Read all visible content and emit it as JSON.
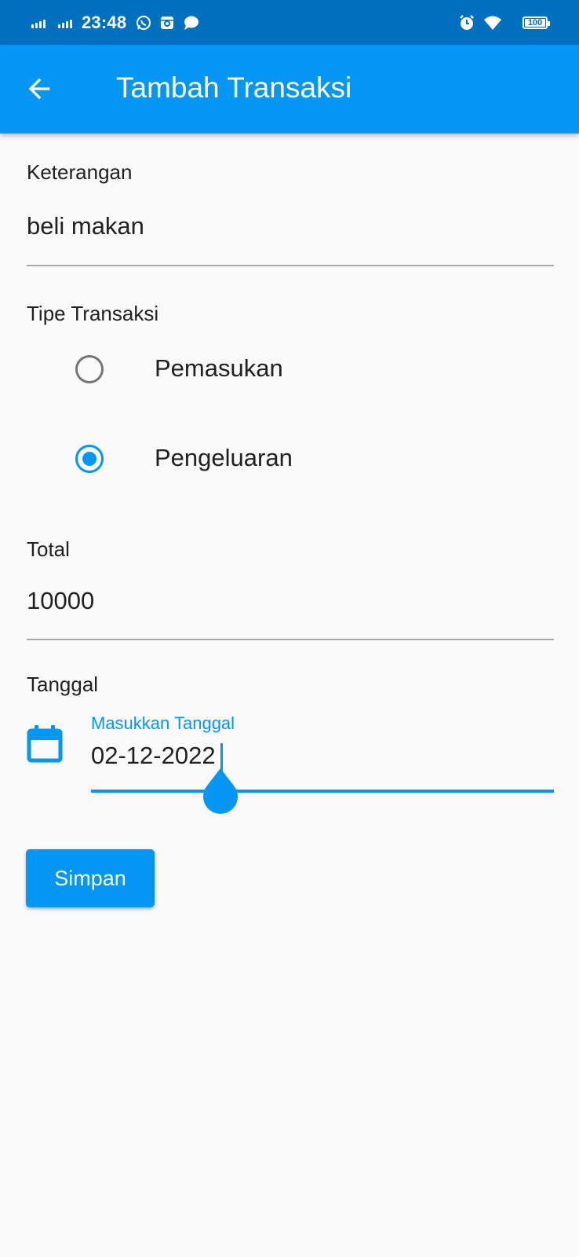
{
  "status_bar": {
    "time": "23:48",
    "battery": "100",
    "left_icons": [
      "signal-icon",
      "signal-icon",
      "whatsapp-icon",
      "instagram-icon",
      "message-icon"
    ],
    "right_icons": [
      "alarm-icon",
      "wifi-icon",
      "battery-icon"
    ]
  },
  "app_bar": {
    "title": "Tambah Transaksi",
    "back_icon": "arrow-left-icon",
    "color": "#0396f2"
  },
  "form": {
    "keterangan": {
      "label": "Keterangan",
      "value": "beli makan"
    },
    "tipe": {
      "label": "Tipe Transaksi",
      "options": [
        {
          "label": "Pemasukan",
          "selected": false
        },
        {
          "label": "Pengeluaran",
          "selected": true
        }
      ]
    },
    "total": {
      "label": "Total",
      "value": "10000"
    },
    "tanggal": {
      "label": "Tanggal",
      "input_label": "Masukkan Tanggal",
      "value": "02-12-2022",
      "icon": "calendar-icon"
    },
    "save_label": "Simpan"
  },
  "colors": {
    "primary": "#0396f2",
    "status_bar": "#0170bf",
    "background": "#fafafa"
  }
}
